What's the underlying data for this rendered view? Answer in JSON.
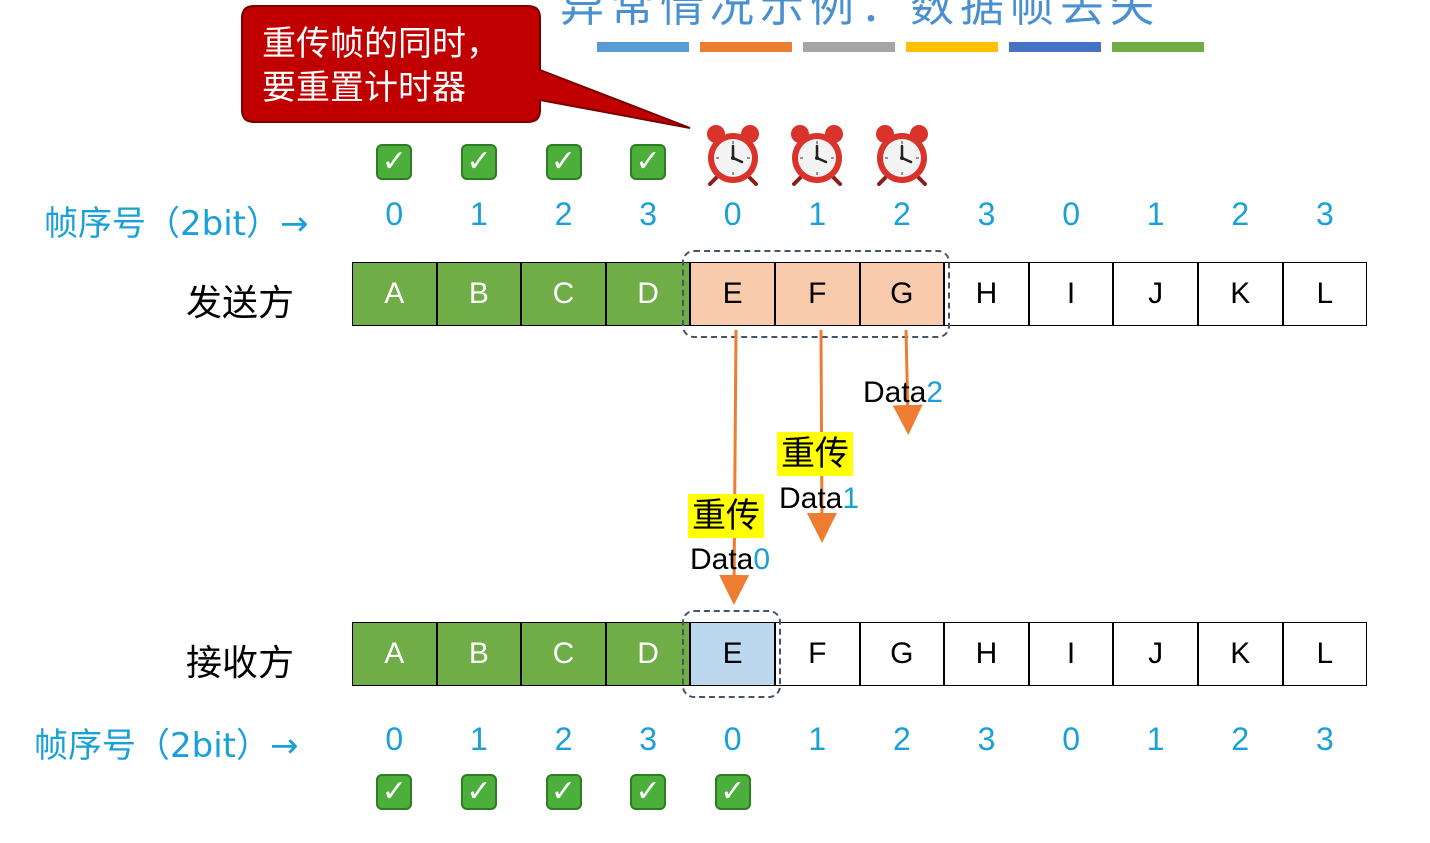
{
  "title_fragment": "异常情况示例：数据帧丢失",
  "colors": {
    "stripes": [
      "#5b9bd5",
      "#ed7d31",
      "#a5a5a5",
      "#ffc000",
      "#4472c4",
      "#70ad47"
    ],
    "callout_fill": "#c00000",
    "frame_green": "#70ad47",
    "window_send": "#f8cbad",
    "window_recv": "#bdd7ee",
    "seq_blue": "#1aa0d8",
    "arrow_orange": "#ed7d31"
  },
  "callout": {
    "line1": "重传帧的同时，",
    "line2": "要重置计时器"
  },
  "check_glyph": "✓",
  "sender": {
    "label": "发送方",
    "seq_label": "帧序号（2bit）→",
    "seq": [
      "0",
      "1",
      "2",
      "3",
      "0",
      "1",
      "2",
      "3",
      "0",
      "1",
      "2",
      "3"
    ],
    "frames": [
      "A",
      "B",
      "C",
      "D",
      "E",
      "F",
      "G",
      "H",
      "I",
      "J",
      "K",
      "L"
    ],
    "acked_count": 4,
    "timer_count": 3,
    "window_range": [
      4,
      6
    ]
  },
  "receiver": {
    "label": "接收方",
    "seq_label": "帧序号（2bit）→",
    "seq": [
      "0",
      "1",
      "2",
      "3",
      "0",
      "1",
      "2",
      "3",
      "0",
      "1",
      "2",
      "3"
    ],
    "frames": [
      "A",
      "B",
      "C",
      "D",
      "E",
      "F",
      "G",
      "H",
      "I",
      "J",
      "K",
      "L"
    ],
    "received_count": 5,
    "window_range": [
      4,
      4
    ]
  },
  "transmissions": [
    {
      "retransmit_tag": "重传",
      "data_word": "Data",
      "index": "0"
    },
    {
      "retransmit_tag": "重传",
      "data_word": "Data",
      "index": "1"
    },
    {
      "retransmit_tag": "",
      "data_word": "Data",
      "index": "2"
    }
  ]
}
